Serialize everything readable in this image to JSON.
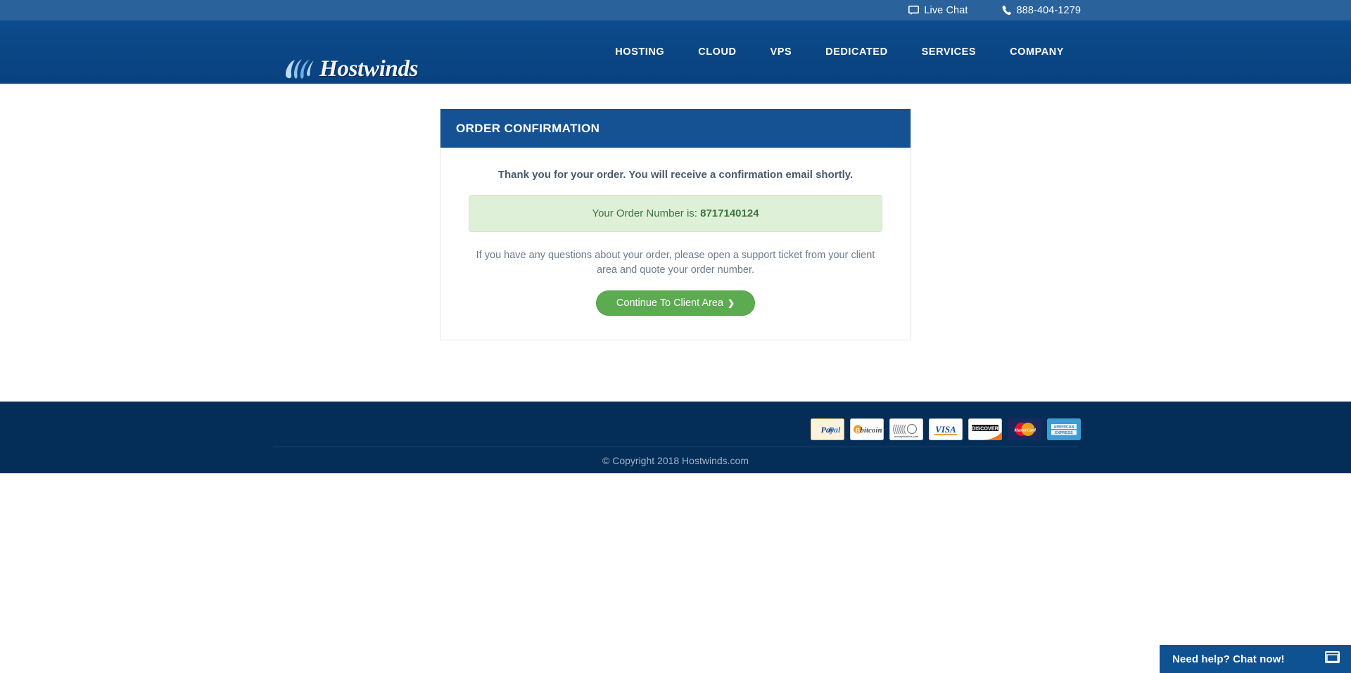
{
  "topbar": {
    "live_chat": {
      "label": "Live Chat",
      "icon": "chat-bubble-icon"
    },
    "phone": {
      "label": "888-404-1279",
      "icon": "phone-icon"
    },
    "background_color": "#2a629c"
  },
  "header": {
    "logo_text": "Hostwinds",
    "logo_icon": "wind-swirl-icon",
    "background_color": "#0a4584",
    "nav": [
      {
        "label": "HOSTING"
      },
      {
        "label": "CLOUD"
      },
      {
        "label": "VPS"
      },
      {
        "label": "DEDICATED"
      },
      {
        "label": "SERVICES"
      },
      {
        "label": "COMPANY"
      }
    ]
  },
  "main": {
    "card_title": "ORDER CONFIRMATION",
    "card_title_bg": "#145293",
    "thanks_message": "Thank you for your order. You will receive a confirmation email shortly.",
    "order_number_prefix": "Your Order Number is: ",
    "order_number": "8717140124",
    "alert_bg": "#dff0d8",
    "alert_text_color": "#3c763d",
    "support_text": "If you have any questions about your order, please open a support ticket from your client area and quote your order number.",
    "continue_button": {
      "label": "Continue To Client Area",
      "icon": "chevron-right-icon",
      "color": "#5cab51"
    }
  },
  "footer": {
    "background_color": "#042d57",
    "payment_methods": [
      {
        "name": "paypal-icon",
        "label": "PayPal"
      },
      {
        "name": "bitcoin-icon",
        "label": "bitcoin"
      },
      {
        "name": "moneybookers-icon",
        "label": "moneybookers.com"
      },
      {
        "name": "visa-icon",
        "label": "VISA"
      },
      {
        "name": "discover-icon",
        "label": "DISCOVER"
      },
      {
        "name": "mastercard-icon",
        "label": "MasterCard"
      },
      {
        "name": "amex-icon",
        "label": "AMERICAN EXPRESS"
      }
    ],
    "copyright": "© Copyright 2018 Hostwinds.com"
  },
  "chat_widget": {
    "label": "Need help? Chat now!",
    "icon": "window-maximize-icon",
    "background_color": "#0f5291"
  }
}
